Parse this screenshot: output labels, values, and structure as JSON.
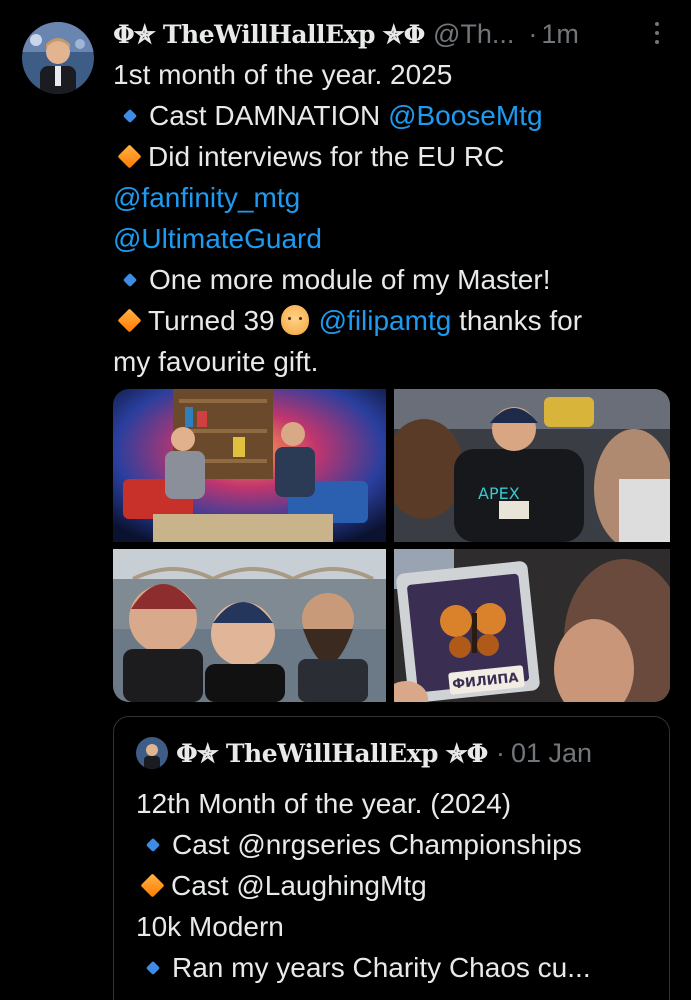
{
  "tweet": {
    "display_name": "Φ✯ TheWillHallExp ✯Φ",
    "handle": "@Th...",
    "separator": "·",
    "time": "1m",
    "lines": {
      "l1": "1st month of the year. 2025",
      "l2_text": "Cast DAMNATION ",
      "l2_mention": "@BooseMtg",
      "l3_text": "Did interviews for the EU RC",
      "l4_mention": "@fanfinity_mtg",
      "l5_mention": "@UltimateGuard",
      "l6_text": "One more module of my Master!",
      "l7_text_a": "Turned 39",
      "l7_mention": "@filipamtg",
      "l7_text_b": " thanks for",
      "l8": "my favourite gift."
    },
    "card_text": "ФИЛИПА"
  },
  "quoted": {
    "display_name": "Φ✯ TheWillHallExp ✯Φ",
    "separator": "·",
    "date": "01 Jan",
    "lines": {
      "l1": "12th Month of the year. (2024)",
      "l2": "Cast @nrgseries Championships",
      "l3": "Cast @LaughingMtg",
      "l4": "10k Modern",
      "l5": "Ran my years Charity Chaos cu..."
    }
  },
  "colors": {
    "background": "#000000",
    "text": "#e7e9ea",
    "muted": "#71767b",
    "link": "#1d9bf0",
    "border": "#2f3336",
    "diamond_blue": "#3f8ce6",
    "diamond_orange": "#ff8c1a"
  },
  "icons": [
    "more-icon",
    "small-blue-diamond-icon",
    "large-orange-diamond-icon",
    "pouting-face-emoji-icon"
  ]
}
